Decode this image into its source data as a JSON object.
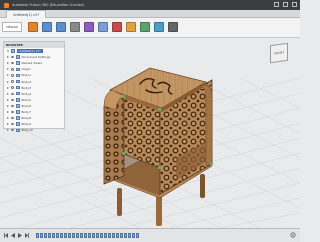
{
  "window": {
    "title": "Autodesk Fusion 360 (Education License)"
  },
  "document_tab": {
    "label": "Untitled(1) v1*"
  },
  "toolbar": {
    "workspace_label": "DESIGN",
    "tools": [
      {
        "name": "create-sketch-icon",
        "color": "#e5822a"
      },
      {
        "name": "extrude-icon",
        "color": "#5d8fd0"
      },
      {
        "name": "revolve-icon",
        "color": "#5d8fd0"
      },
      {
        "name": "line-icon",
        "color": "#8a8a8a"
      },
      {
        "name": "modify-icon",
        "color": "#8e5bc4"
      },
      {
        "name": "fillet-icon",
        "color": "#7a9fd6"
      },
      {
        "name": "joint-icon",
        "color": "#c84b4b"
      },
      {
        "name": "construct-icon",
        "color": "#e4a33a"
      },
      {
        "name": "inspect-icon",
        "color": "#5aa36b"
      },
      {
        "name": "insert-icon",
        "color": "#4b9ec8"
      },
      {
        "name": "select-icon",
        "color": "#666666"
      }
    ]
  },
  "browser": {
    "title": "BROWSER",
    "items": [
      {
        "label": "Document Settings"
      },
      {
        "label": "Named Views"
      },
      {
        "label": "Origin"
      },
      {
        "label": "Body1"
      },
      {
        "label": "Body2"
      },
      {
        "label": "Body3"
      },
      {
        "label": "Body4"
      },
      {
        "label": "Body5"
      },
      {
        "label": "Body6"
      },
      {
        "label": "Body7"
      },
      {
        "label": "Body8"
      },
      {
        "label": "Body9"
      },
      {
        "label": "Body10"
      }
    ]
  },
  "viewcube": {
    "label": "FRONT"
  },
  "colors": {
    "wood_light": "#c79a67",
    "wood_mid": "#a8784a",
    "wood_dark": "#7c5330",
    "grid": "#cfd2d6",
    "selection": "#3f6fb5"
  }
}
